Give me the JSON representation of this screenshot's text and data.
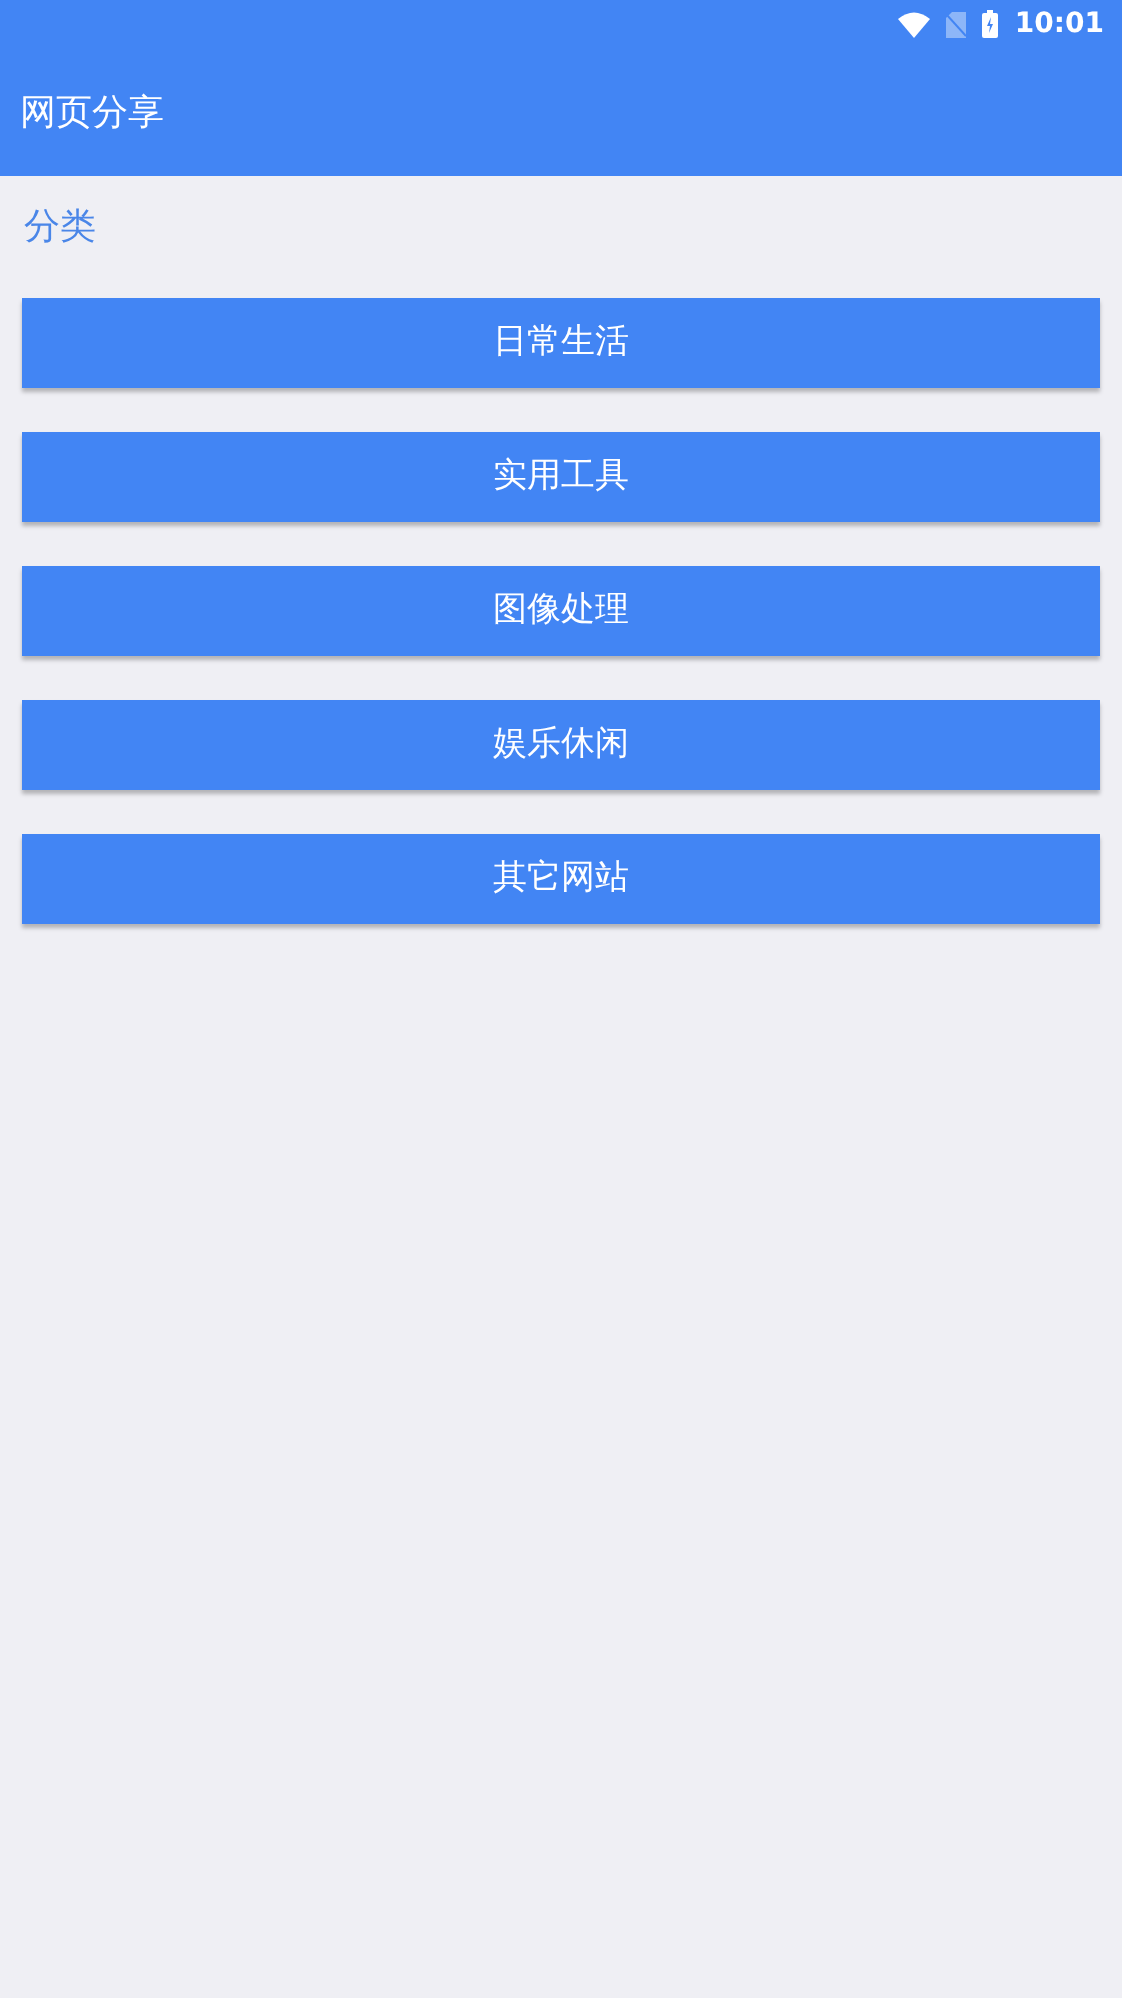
{
  "status_bar": {
    "time": "10:01"
  },
  "app_bar": {
    "title": "网页分享"
  },
  "section": {
    "label": "分类"
  },
  "categories": [
    {
      "label": "日常生活"
    },
    {
      "label": "实用工具"
    },
    {
      "label": "图像处理"
    },
    {
      "label": "娱乐休闲"
    },
    {
      "label": "其它网站"
    }
  ]
}
